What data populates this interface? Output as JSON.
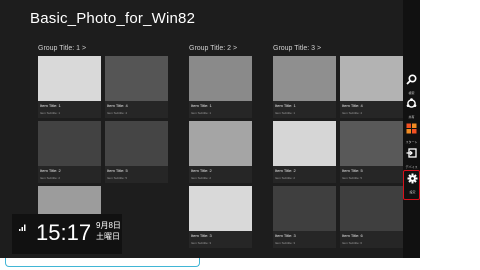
{
  "app": {
    "title": "Basic_Photo_for_Win82"
  },
  "groups": [
    {
      "title": "Group Title: 1 >",
      "items": [
        {
          "title": "Item Title: 1",
          "subtitle": "Item Subtitle: 1",
          "color": "#d9d9d9"
        },
        {
          "title": "Item Title: 4",
          "subtitle": "Item Subtitle: 4",
          "color": "#555555"
        },
        {
          "title": "Item Title: 2",
          "subtitle": "Item Subtitle: 2",
          "color": "#424242"
        },
        {
          "title": "Item Title: 5",
          "subtitle": "Item Subtitle: 5",
          "color": "#454545"
        },
        {
          "title": "",
          "subtitle": "",
          "color": "#9c9c9c"
        }
      ]
    },
    {
      "title": "Group Title: 2 >",
      "items": [
        {
          "title": "Item Title: 1",
          "subtitle": "Item Subtitle: 1",
          "color": "#8a8a8a"
        },
        {
          "title": "Item Title: 2",
          "subtitle": "Item Subtitle: 2",
          "color": "#a5a5a5"
        },
        {
          "title": "Item Title: 3",
          "subtitle": "Item Subtitle: 3",
          "color": "#d9d9d9"
        }
      ]
    },
    {
      "title": "Group Title: 3 >",
      "items": [
        {
          "title": "Item Title: 1",
          "subtitle": "Item Subtitle: 1",
          "color": "#8f8f8f"
        },
        {
          "title": "Item Title: 4",
          "subtitle": "Item Subtitle: 4",
          "color": "#b3b3b3"
        },
        {
          "title": "Item Title: 2",
          "subtitle": "Item Subtitle: 2",
          "color": "#d6d6d6"
        },
        {
          "title": "Item Title: 5",
          "subtitle": "Item Subtitle: 5",
          "color": "#595959"
        },
        {
          "title": "Item Title: 3",
          "subtitle": "Item Subtitle: 3",
          "color": "#3f3f3f"
        },
        {
          "title": "Item Title: 6",
          "subtitle": "Item Subtitle: 6",
          "color": "#3f3f3f"
        }
      ]
    }
  ],
  "clock": {
    "network_icon": "signal-icon",
    "time": "15:17",
    "date": "9月8日",
    "day": "土曜日"
  },
  "charms": [
    {
      "label": "検索",
      "icon": "search-icon"
    },
    {
      "label": "共有",
      "icon": "share-icon"
    },
    {
      "label": "スタート",
      "icon": "windows-logo-icon"
    },
    {
      "label": "デバイス",
      "icon": "devices-icon"
    },
    {
      "label": "設定",
      "icon": "gear-icon"
    }
  ],
  "colors": {
    "background": "#1d1d1d",
    "charm_bar": "#111111",
    "highlight": "#d8121c",
    "scroll_indicator": "#41b6d6"
  }
}
